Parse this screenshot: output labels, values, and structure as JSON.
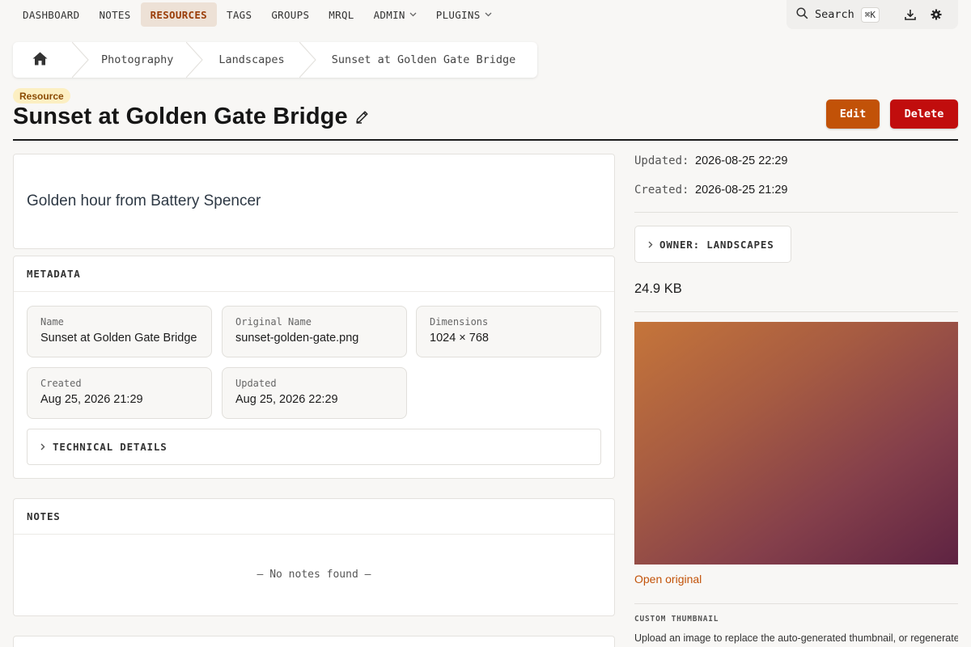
{
  "nav": {
    "items": [
      {
        "label": "DASHBOARD",
        "active": false,
        "dropdown": false
      },
      {
        "label": "NOTES",
        "active": false,
        "dropdown": false
      },
      {
        "label": "RESOURCES",
        "active": true,
        "dropdown": false
      },
      {
        "label": "TAGS",
        "active": false,
        "dropdown": false
      },
      {
        "label": "GROUPS",
        "active": false,
        "dropdown": false
      },
      {
        "label": "MRQL",
        "active": false,
        "dropdown": false
      },
      {
        "label": "ADMIN",
        "active": false,
        "dropdown": true
      },
      {
        "label": "PLUGINS",
        "active": false,
        "dropdown": true
      }
    ],
    "search_label": "Search",
    "search_shortcut": "⌘K",
    "icons": [
      "search-icon",
      "download-icon",
      "gear-icon"
    ]
  },
  "breadcrumb": {
    "home_icon": "home-icon",
    "items": [
      "Photography",
      "Landscapes",
      "Sunset at Golden Gate Bridge"
    ]
  },
  "header": {
    "type_badge": "Resource",
    "title": "Sunset at Golden Gate Bridge",
    "edit_icon": "pencil-icon",
    "edit_label": "Edit",
    "delete_label": "Delete"
  },
  "description": "Golden hour from Battery Spencer",
  "metadata": {
    "heading": "METADATA",
    "fields": [
      {
        "label": "Name",
        "value": "Sunset at Golden Gate Bridge"
      },
      {
        "label": "Original Name",
        "value": "sunset-golden-gate.png"
      },
      {
        "label": "Dimensions",
        "value": "1024 × 768"
      },
      {
        "label": "Created",
        "value": "Aug 25, 2026 21:29"
      },
      {
        "label": "Updated",
        "value": "Aug 25, 2026 22:29"
      }
    ],
    "technical_label": "TECHNICAL DETAILS"
  },
  "notes": {
    "heading": "NOTES",
    "empty": "— No notes found —"
  },
  "sidebar": {
    "updated_label": "Updated:",
    "updated_value": "2026-08-25 22:29",
    "created_label": "Created:",
    "created_value": "2026-08-25 21:29",
    "owner_label": "OWNER: LANDSCAPES",
    "file_size": "24.9 KB",
    "open_original": "Open original",
    "custom_thumbnail_label": "CUSTOM THUMBNAIL",
    "custom_thumbnail_desc": "Upload an image to replace the auto-generated thumbnail, or regenerate"
  },
  "colors": {
    "accent": "#c25208",
    "danger": "#c10d0d",
    "nav_active_bg": "#ede1d6",
    "badge_bg": "#fcefc2"
  }
}
